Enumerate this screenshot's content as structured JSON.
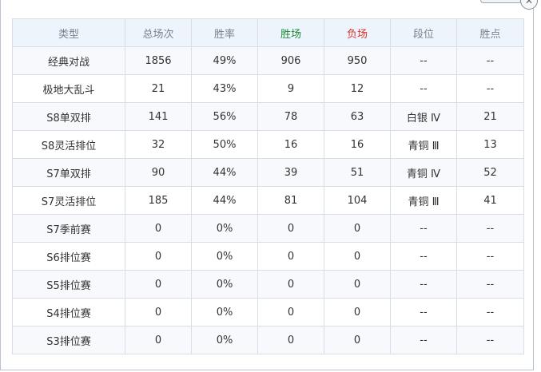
{
  "columns": [
    {
      "key": "type",
      "label": "类型"
    },
    {
      "key": "total",
      "label": "总场次"
    },
    {
      "key": "rate",
      "label": "胜率"
    },
    {
      "key": "win",
      "label": "胜场"
    },
    {
      "key": "loss",
      "label": "负场"
    },
    {
      "key": "rank",
      "label": "段位"
    },
    {
      "key": "points",
      "label": "胜点"
    }
  ],
  "rows": [
    {
      "type": "经典对战",
      "total": "1856",
      "rate": "49%",
      "win": "906",
      "loss": "950",
      "rank": "--",
      "points": "--"
    },
    {
      "type": "极地大乱斗",
      "total": "21",
      "rate": "43%",
      "win": "9",
      "loss": "12",
      "rank": "--",
      "points": "--"
    },
    {
      "type": "S8单双排",
      "total": "141",
      "rate": "56%",
      "win": "78",
      "loss": "63",
      "rank": "白银 Ⅳ",
      "points": "21"
    },
    {
      "type": "S8灵活排位",
      "total": "32",
      "rate": "50%",
      "win": "16",
      "loss": "16",
      "rank": "青铜 Ⅲ",
      "points": "13"
    },
    {
      "type": "S7单双排",
      "total": "90",
      "rate": "44%",
      "win": "39",
      "loss": "51",
      "rank": "青铜 Ⅳ",
      "points": "52"
    },
    {
      "type": "S7灵活排位",
      "total": "185",
      "rate": "44%",
      "win": "81",
      "loss": "104",
      "rank": "青铜 Ⅲ",
      "points": "41"
    },
    {
      "type": "S7季前赛",
      "total": "0",
      "rate": "0%",
      "win": "0",
      "loss": "0",
      "rank": "--",
      "points": "--"
    },
    {
      "type": "S6排位赛",
      "total": "0",
      "rate": "0%",
      "win": "0",
      "loss": "0",
      "rank": "--",
      "points": "--"
    },
    {
      "type": "S5排位赛",
      "total": "0",
      "rate": "0%",
      "win": "0",
      "loss": "0",
      "rank": "--",
      "points": "--"
    },
    {
      "type": "S4排位赛",
      "total": "0",
      "rate": "0%",
      "win": "0",
      "loss": "0",
      "rank": "--",
      "points": "--"
    },
    {
      "type": "S3排位赛",
      "total": "0",
      "rate": "0%",
      "win": "0",
      "loss": "0",
      "rank": "--",
      "points": "--"
    }
  ],
  "colors": {
    "win_header": "#1f8a3a",
    "loss_header": "#d8342a",
    "header_bg": "#eef4fb"
  },
  "icons": {
    "close": "close-icon"
  }
}
